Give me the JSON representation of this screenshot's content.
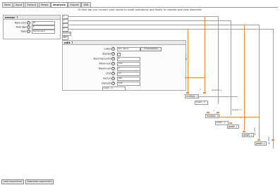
{
  "tabs": [
    "Main",
    "Input",
    "Output",
    "Views",
    "Analysis",
    "Export",
    "XML"
  ],
  "active_tab": "Analysis",
  "intro": "On this tab you connect your inputs to math operations and finally to outputs and view elements.",
  "sensor": {
    "title": "sensor ↑",
    "rate_label": "Rate (Hz)",
    "rate_value": "20",
    "average_label": "Average",
    "average_value": "4",
    "type_label": "Type",
    "type_value": "Gyroscope",
    "outputs": [
      "x",
      "y",
      "z",
      "t",
      "accuracy",
      "abs"
    ]
  },
  "edit": {
    "title": "edit ↑",
    "label_label": "Label",
    "label_value": "Roll radius",
    "translations_button": "0 Translations",
    "signed_label": "Signed",
    "decimal_label": "Decimal point",
    "decimal_value": "4",
    "minimum_label": "Minimum",
    "minimum_value": "0.01",
    "maximum_label": "Maximum",
    "maximum_value": "1",
    "unit_label": "Unit",
    "unit_value": "cm",
    "factor_label": "Factor",
    "factor_value": "100",
    "default_label": "Default",
    "default_value": "0.05",
    "insert_label": "insert..."
  },
  "nodes": {
    "multiply1": "multiply ↓",
    "multiply2": "multiply ↓",
    "insert1": "insert...",
    "insert2": "insert...",
    "graph1": "graph ↓",
    "graph2": "graph ↓",
    "graph3": "graph ↓"
  },
  "wire_labels": {
    "w1": "roll_r = r",
    "w2": "product = a",
    "w3": "b",
    "w4": "b",
    "w5": "product = x",
    "w6": "y",
    "w7": "b",
    "w8": "gyr_time",
    "w9": "gyr_time"
  },
  "footer": {
    "load": "Load experiment",
    "download": "Download experiment"
  },
  "colors": {
    "wire": "#f08a3c"
  }
}
